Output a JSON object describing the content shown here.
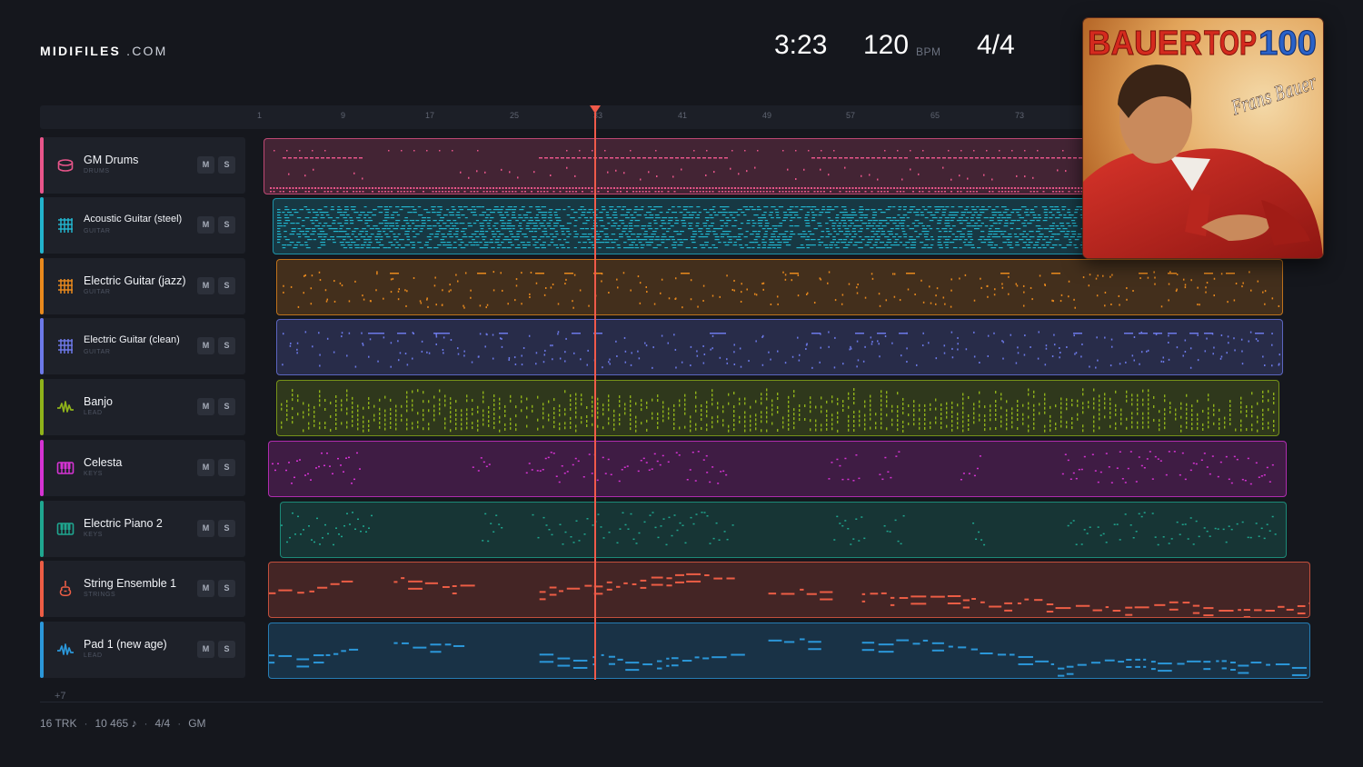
{
  "brand": {
    "name": "MIDIFILES",
    "suffix": ".COM"
  },
  "header": {
    "duration": "3:23",
    "tempo": "120",
    "tempo_unit": "BPM",
    "time_signature": "4/4"
  },
  "ruler": {
    "bars": [
      "1",
      "9",
      "17",
      "25",
      "33",
      "41",
      "49",
      "57",
      "65",
      "73"
    ]
  },
  "playhead": {
    "bar": 33
  },
  "tracks": [
    {
      "name": "GM Drums",
      "category": "DRUMS",
      "color": "#e8558a",
      "icon": "drum-icon",
      "mute": "M",
      "solo": "S"
    },
    {
      "name": "Acoustic Guitar (steel)",
      "category": "GUITAR",
      "color": "#22b3cc",
      "icon": "grid-icon",
      "mute": "M",
      "solo": "S"
    },
    {
      "name": "Electric Guitar (jazz)",
      "category": "GUITAR",
      "color": "#e8891d",
      "icon": "grid-icon",
      "mute": "M",
      "solo": "S"
    },
    {
      "name": "Electric Guitar (clean)",
      "category": "GUITAR",
      "color": "#6c79e8",
      "icon": "grid-icon",
      "mute": "M",
      "solo": "S"
    },
    {
      "name": "Banjo",
      "category": "LEAD",
      "color": "#8fb21a",
      "icon": "wave-icon",
      "mute": "M",
      "solo": "S"
    },
    {
      "name": "Celesta",
      "category": "KEYS",
      "color": "#d533d3",
      "icon": "keys-icon",
      "mute": "M",
      "solo": "S"
    },
    {
      "name": "Electric Piano 2",
      "category": "KEYS",
      "color": "#1fa68f",
      "icon": "keys-icon",
      "mute": "M",
      "solo": "S"
    },
    {
      "name": "String Ensemble 1",
      "category": "STRINGS",
      "color": "#ec5d45",
      "icon": "violin-icon",
      "mute": "M",
      "solo": "S"
    },
    {
      "name": "Pad 1 (new age)",
      "category": "LEAD",
      "color": "#2b97d9",
      "icon": "wave-icon",
      "mute": "M",
      "solo": "S"
    }
  ],
  "more_tracks": "+7",
  "footer": {
    "tracks": "16 TRK",
    "notes": "10 465 ♪",
    "time_signature": "4/4",
    "standard": "GM"
  },
  "album": {
    "title_left": "BAUER",
    "title_right": "TOP",
    "title_num": "100",
    "artist": "Frans Bauer"
  }
}
